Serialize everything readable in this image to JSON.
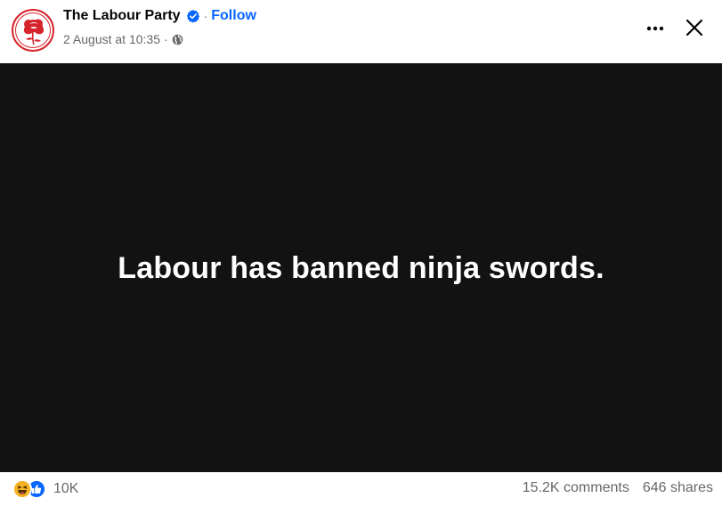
{
  "post": {
    "author": "The Labour Party",
    "separator": "·",
    "follow_label": "Follow",
    "timestamp": "2 August at 10:35",
    "meta_separator": "·",
    "audience_icon": "globe-icon",
    "verified_icon": "verified-badge-icon",
    "more_icon": "more-options-icon",
    "close_icon": "close-icon"
  },
  "media": {
    "text": "Labour has banned ninja swords.",
    "background": "#121212",
    "text_color": "#ffffff"
  },
  "footer": {
    "reaction_icons": [
      "haha-icon",
      "like-icon"
    ],
    "reaction_count": "10K",
    "comments": "15.2K comments",
    "shares": "646 shares"
  },
  "colors": {
    "accent": "#0866ff",
    "secondary_text": "#65676b",
    "logo_red": "#d6242c"
  }
}
